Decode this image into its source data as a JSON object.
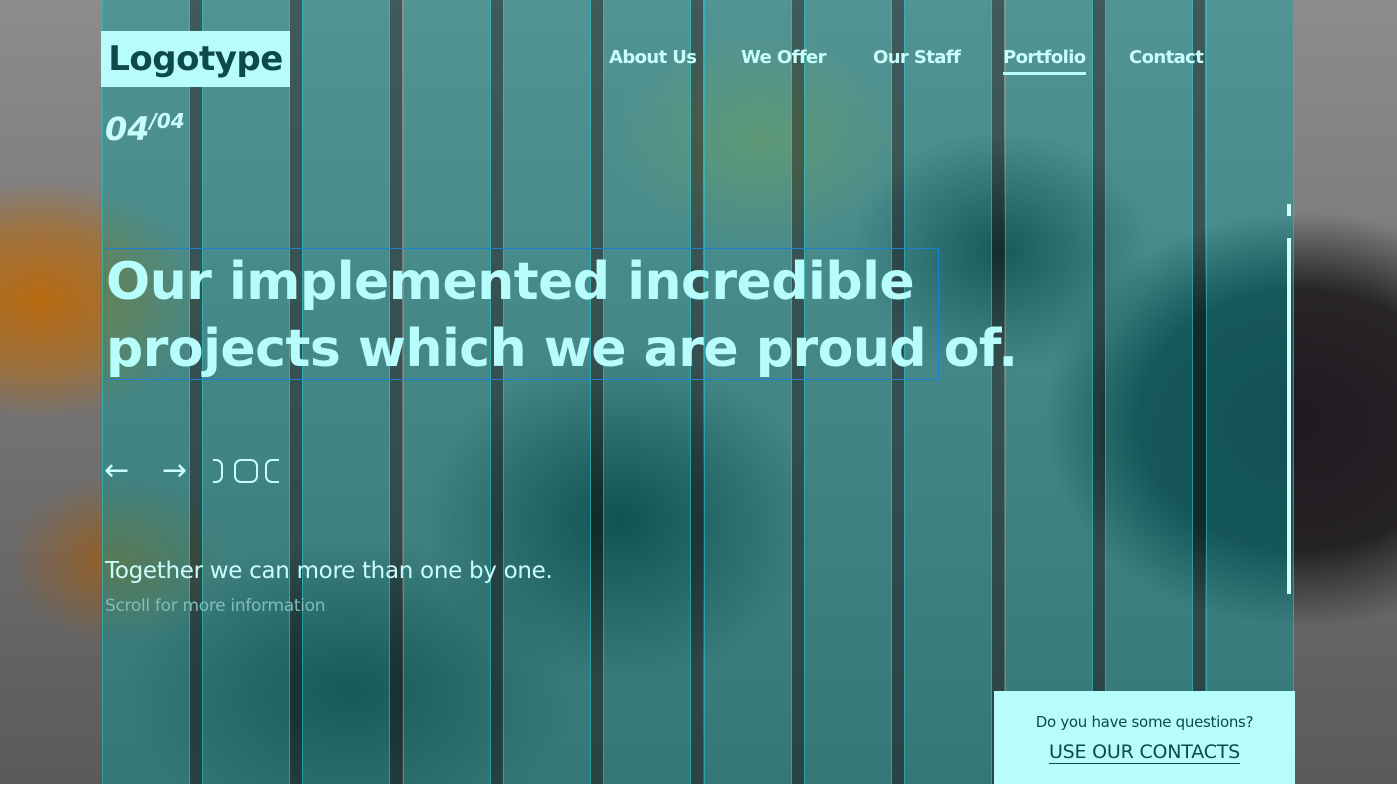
{
  "brand": {
    "logo_text": "Logotype"
  },
  "nav": {
    "items": [
      {
        "label": "About Us"
      },
      {
        "label": "We Offer"
      },
      {
        "label": "Our Staff"
      },
      {
        "label": "Portfolio",
        "active": true
      },
      {
        "label": "Contact"
      }
    ]
  },
  "slider": {
    "current": "04",
    "total": "/04",
    "prev_icon": "arrow-left-icon",
    "next_icon": "arrow-right-icon",
    "dots_icon": "slide-dots-icon"
  },
  "hero": {
    "headline_line1": "Our implemented incredible",
    "headline_line2": "projects which we are proud of.",
    "tagline": "Together we can more than one by one.",
    "scroll_hint": "Scroll for more information"
  },
  "contact_box": {
    "question": "Do you have some questions?",
    "link": "USE OUR CONTACTS"
  },
  "colors": {
    "accent": "#b6fdfb",
    "text_light": "#c8fdfb",
    "text_dark": "#0e4a49",
    "grid_overlay": "#00a0a0",
    "selection_border": "#1d7fd6"
  }
}
